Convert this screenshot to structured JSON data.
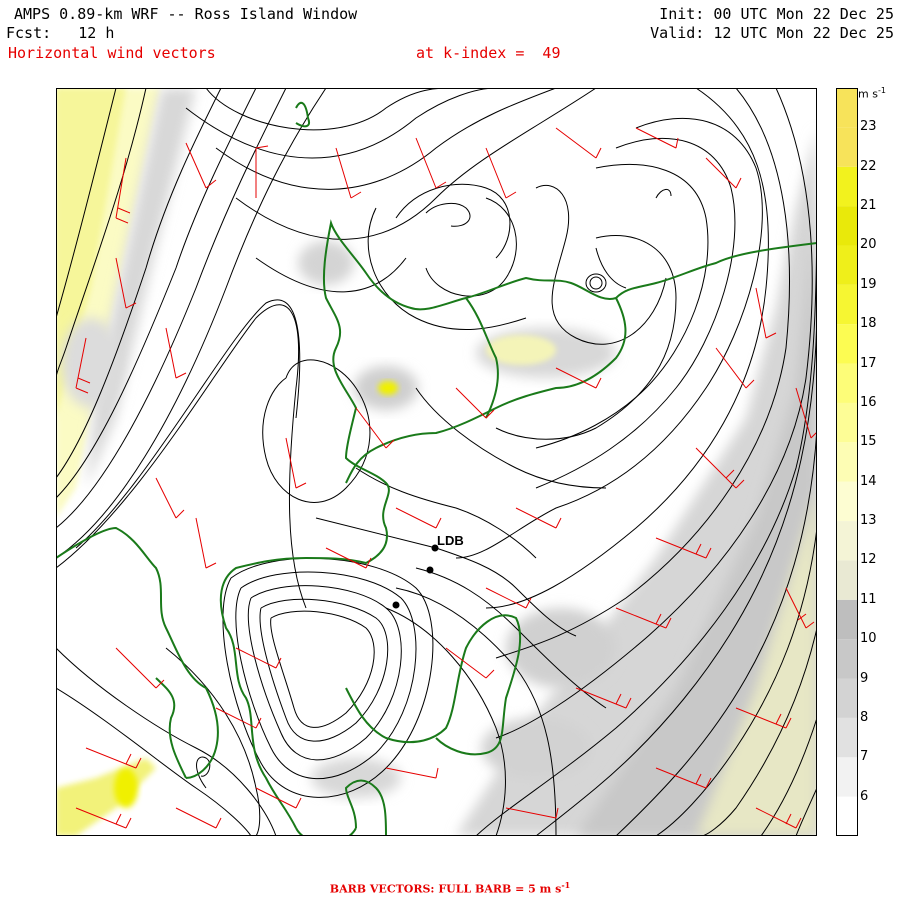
{
  "header": {
    "title": "AMPS 0.89-km WRF -- Ross Island Window",
    "forecast_label": "Fcst:",
    "forecast_value": "12 h",
    "field": "Horizontal wind vectors",
    "init": "Init: 00 UTC Mon 22 Dec 25",
    "valid": "Valid: 12 UTC Mon 22 Dec 25",
    "level": "at k-index =  49"
  },
  "colorbar": {
    "units_base": "m s",
    "units_exp": "-1",
    "ticks": [
      "6",
      "7",
      "8",
      "9",
      "10",
      "11",
      "12",
      "13",
      "14",
      "15",
      "16",
      "17",
      "18",
      "19",
      "20",
      "21",
      "22",
      "23"
    ],
    "colors": [
      "#ffffff",
      "#f2f2f2",
      "#e1e1e1",
      "#d3d3d3",
      "#c8c8c8",
      "#bebebe",
      "#e9e9d3",
      "#f4f4d6",
      "#fdfdd2",
      "#fdfdb4",
      "#fdfd96",
      "#fdfd78",
      "#fcfc52",
      "#f6f632",
      "#efef1a",
      "#e9e90a",
      "#f2f21e",
      "#f7e35a"
    ]
  },
  "map": {
    "station": "LDB",
    "colors": {
      "contour": "#000000",
      "coast": "#1a7a1a",
      "barb": "#e60000"
    }
  },
  "footer": {
    "text": "BARB VECTORS:  FULL BARB = 5 m s",
    "exp": "-1"
  }
}
